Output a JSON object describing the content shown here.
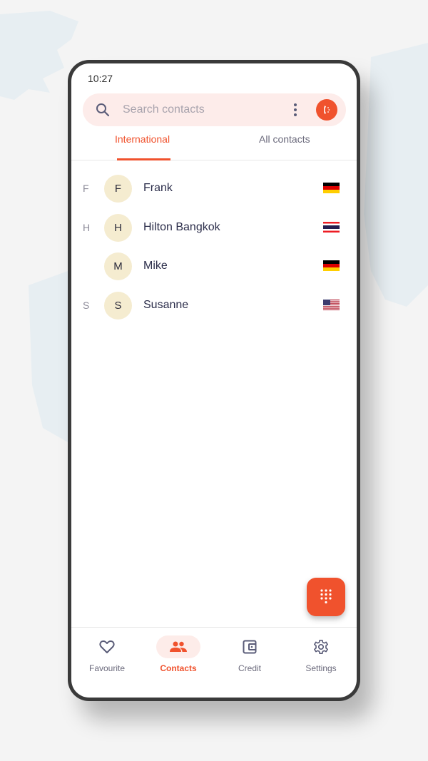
{
  "status_bar": {
    "time": "10:27"
  },
  "search": {
    "placeholder": "Search contacts",
    "value": ""
  },
  "tabs": [
    {
      "label": "International",
      "active": true
    },
    {
      "label": "All contacts",
      "active": false
    }
  ],
  "contacts": [
    {
      "section": "F",
      "initial": "F",
      "name": "Frank",
      "flag": "germany"
    },
    {
      "section": "H",
      "initial": "H",
      "name": "Hilton Bangkok",
      "flag": "thailand"
    },
    {
      "section": "",
      "initial": "M",
      "name": "Mike",
      "flag": "germany"
    },
    {
      "section": "S",
      "initial": "S",
      "name": "Susanne",
      "flag": "usa"
    }
  ],
  "bottom_nav": [
    {
      "label": "Favourite",
      "icon": "heart-icon",
      "active": false
    },
    {
      "label": "Contacts",
      "icon": "people-icon",
      "active": true
    },
    {
      "label": "Credit",
      "icon": "wallet-icon",
      "active": false
    },
    {
      "label": "Settings",
      "icon": "gear-icon",
      "active": false
    }
  ],
  "colors": {
    "accent": "#f0522d",
    "search_bg": "#fdecea",
    "avatar_bg": "#f5ecd0",
    "text": "#2b2d4a"
  }
}
